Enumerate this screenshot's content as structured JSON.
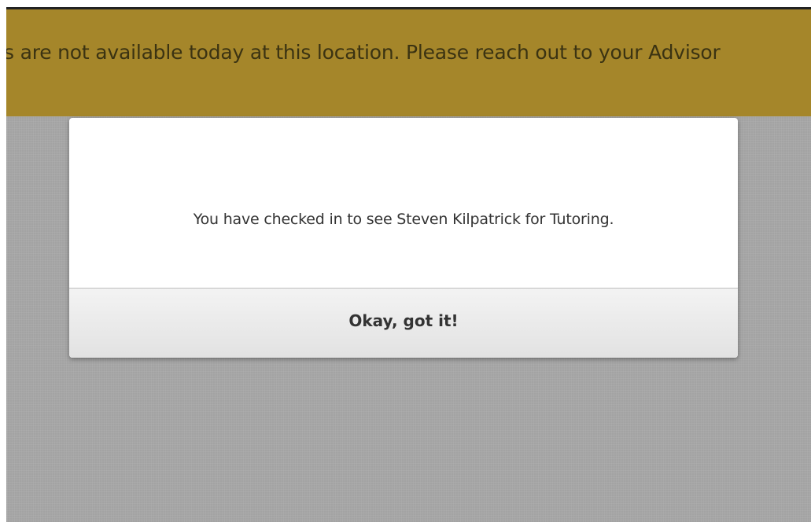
{
  "banner": {
    "text": "s are not available today at this location. Please reach out to your Advisor"
  },
  "modal": {
    "message": "You have checked in to see Steven Kilpatrick for Tutoring.",
    "confirm_label": "Okay, got it!"
  },
  "colors": {
    "banner_bg": "#a5862a",
    "overlay_bg": "#a3a3a3",
    "modal_bg": "#ffffff",
    "button_bg": "#ececec"
  }
}
